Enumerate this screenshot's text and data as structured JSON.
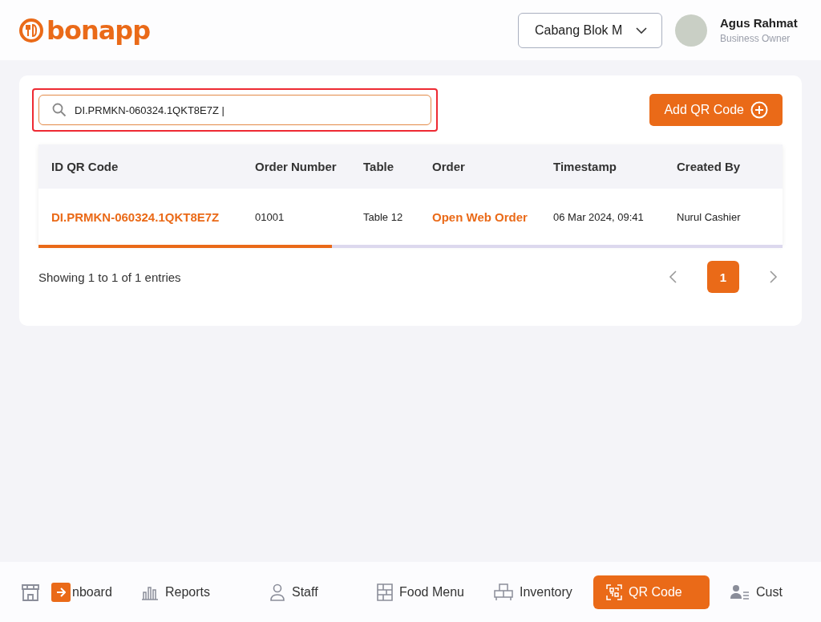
{
  "header": {
    "logo": "bonapp",
    "branch": "Cabang Blok M",
    "user": {
      "name": "Agus Rahmat",
      "role": "Business Owner"
    }
  },
  "search": {
    "value": "DI.PRMKN-060324.1QKT8E7Z |",
    "highlighted": true
  },
  "add_button": "Add QR Code",
  "table": {
    "columns": [
      "ID QR Code",
      "Order Number",
      "Table",
      "Order",
      "Timestamp",
      "Created By"
    ],
    "rows": [
      {
        "id": "DI.PRMKN-060324.1QKT8E7Z",
        "order_number": "01001",
        "table": "Table 12",
        "order": "Open Web Order",
        "timestamp": "06 Mar 2024, 09:41",
        "created_by": "Nurul Cashier"
      }
    ]
  },
  "footer": {
    "summary": "Showing 1 to 1 of 1 entries",
    "pages": [
      {
        "label": "1",
        "selected": true
      }
    ]
  },
  "nav": [
    {
      "label": "nboard",
      "kind": "store",
      "selected": false
    },
    {
      "label": "Reports",
      "kind": "chart",
      "selected": false
    },
    {
      "label": "Staff",
      "kind": "person",
      "selected": false
    },
    {
      "label": "Food Menu",
      "kind": "menu",
      "selected": false
    },
    {
      "label": "Inventory",
      "kind": "boxes",
      "selected": false
    },
    {
      "label": "QR Code",
      "kind": "qr",
      "selected": true
    },
    {
      "label": "Cust",
      "kind": "people",
      "selected": false
    }
  ]
}
